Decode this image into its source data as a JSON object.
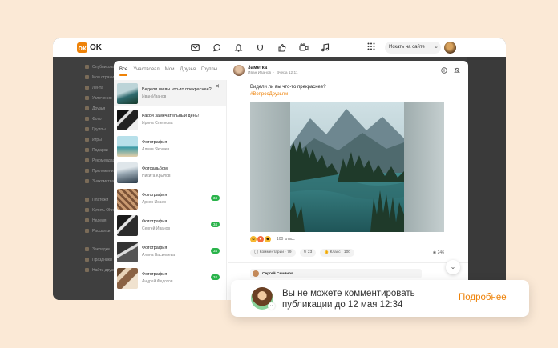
{
  "header": {
    "logo_text": "OK",
    "logo_glyph": "ок",
    "search_placeholder": "Искать на сайте",
    "nav_icons": [
      "mail-icon",
      "discussions-icon",
      "bell-icon",
      "guests-icon",
      "likes-icon",
      "video-icon",
      "music-icon"
    ]
  },
  "sidebar": {
    "items": [
      "Опубликовать",
      "Моя страница",
      "Лента",
      "Увлечения",
      "Друзья",
      "Фото",
      "Группы",
      "Игры",
      "Подарки",
      "Рекомендации",
      "Приложения",
      "Знакомства",
      "",
      "Платежи",
      "Купить ОКи",
      "Неделя",
      "Рассылки",
      "",
      "Закладки",
      "Праздники",
      "Найти друзей"
    ]
  },
  "tabs": [
    "Все",
    "Участвовал",
    "Мои",
    "Друзья",
    "Группы"
  ],
  "list": [
    {
      "title": "Видели ли вы что-то прекраснее?",
      "author": "Иван Иванов",
      "badge": ""
    },
    {
      "title": "Какой замечательный день!",
      "author": "Ирина Слепкова",
      "badge": ""
    },
    {
      "title": "Фотография",
      "author": "Алмаз Якошев",
      "badge": ""
    },
    {
      "title": "Фотоальбом",
      "author": "Никита Крылов",
      "badge": ""
    },
    {
      "title": "Фотография",
      "author": "Арсен Исаев",
      "badge": "34"
    },
    {
      "title": "Фотография",
      "author": "Сергей Иванов",
      "badge": "34"
    },
    {
      "title": "Фотография",
      "author": "Алина Васильева",
      "badge": "34"
    },
    {
      "title": "Фотография",
      "author": "Андрей Федотов",
      "badge": "34"
    }
  ],
  "post": {
    "type": "Заметка",
    "author": "Иван Иванов",
    "time": "Вчера 12:11",
    "text": "Видели ли вы что-то прекраснее?",
    "hashtag": "#ВопросДрузьям",
    "reactions_count": "100 класс",
    "comments_label": "Комментарии · 79",
    "shares_label": "23",
    "likes_label": "Класс · 100",
    "views": "246",
    "commenter": "Сергей Семёнов"
  },
  "toast": {
    "text": "Вы не можете комментировать публикации до 12 мая 12:34",
    "link": "Подробнее"
  },
  "colors": {
    "accent": "#ee8208",
    "badge": "#29b34a"
  }
}
